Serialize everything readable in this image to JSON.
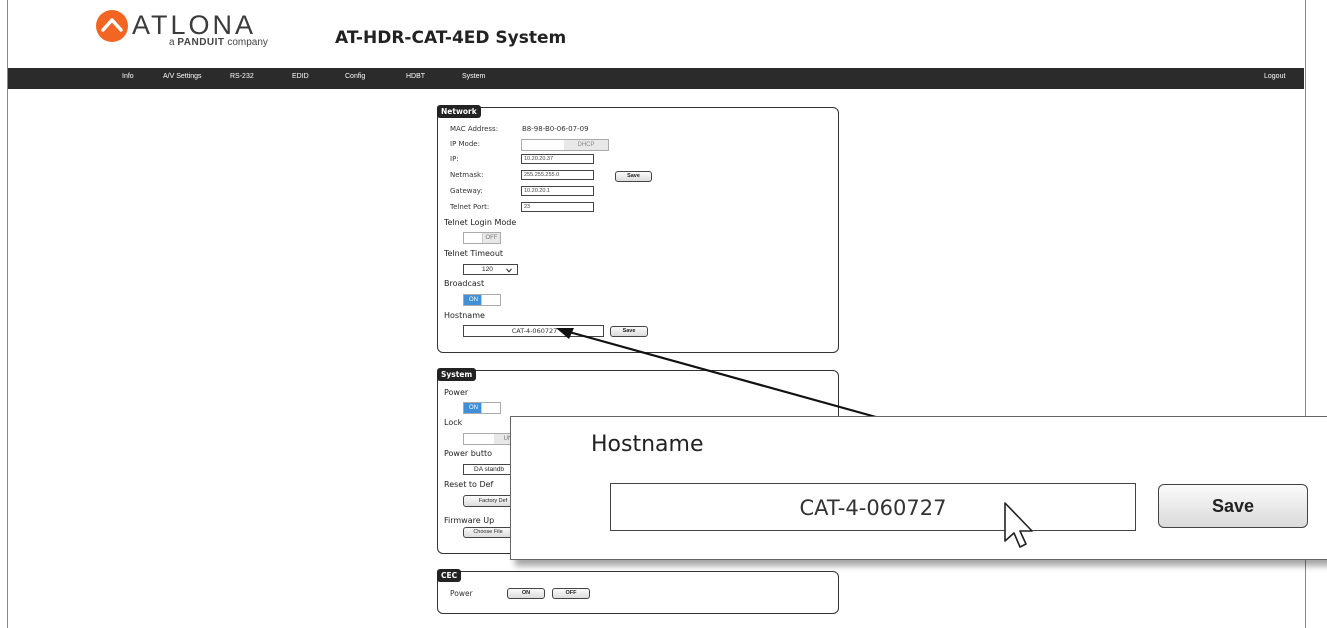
{
  "brand": {
    "name": "ATLONA",
    "tagline_prefix": "a",
    "tagline_brand": "PANDUIT",
    "tagline_suffix": "company",
    "accent_color": "#f26522"
  },
  "header": {
    "title": "AT-HDR-CAT-4ED  System"
  },
  "nav": {
    "items": [
      "Info",
      "A/V Settings",
      "RS-232",
      "EDID",
      "Config",
      "HDBT",
      "System"
    ],
    "logout": "Logout"
  },
  "network": {
    "tag": "Network",
    "mac_label": "MAC Address:",
    "mac_value": "B8-98-B0-06-07-09",
    "ip_mode_label": "IP Mode:",
    "ip_mode_value": "DHCP",
    "ip_label": "IP:",
    "ip_value": "10.20.20.37",
    "netmask_label": "Netmask:",
    "netmask_value": "255.255.255.0",
    "gateway_label": "Gateway:",
    "gateway_value": "10.20.20.1",
    "telnet_port_label": "Telnet Port:",
    "telnet_port_value": "23",
    "save_label": "Save",
    "telnet_login_label": "Telnet Login Mode",
    "telnet_login_value": "OFF",
    "telnet_timeout_label": "Telnet Timeout",
    "telnet_timeout_value": "120",
    "broadcast_label": "Broadcast",
    "broadcast_value": "ON",
    "hostname_label": "Hostname",
    "hostname_value": "CAT-4-060727",
    "hostname_save_label": "Save"
  },
  "system": {
    "tag": "System",
    "power_label": "Power",
    "power_value": "ON",
    "lock_label": "Lock",
    "lock_value": "UN",
    "power_button_label": "Power butto",
    "power_button_value": "DA standb",
    "reset_label": "Reset to Def",
    "factory_button": "Factory Def",
    "firmware_label": "Firmware Up",
    "choose_file": "Choose File"
  },
  "cec": {
    "tag": "CEC",
    "power_label": "Power",
    "on_label": "ON",
    "off_label": "OFF"
  },
  "zoom": {
    "hostname_label": "Hostname",
    "hostname_value": "CAT-4-060727",
    "save_label": "Save"
  },
  "icons": [
    "atlona-logo-icon",
    "cursor-icon",
    "chevron-down-icon",
    "callout-arrow-icon"
  ]
}
